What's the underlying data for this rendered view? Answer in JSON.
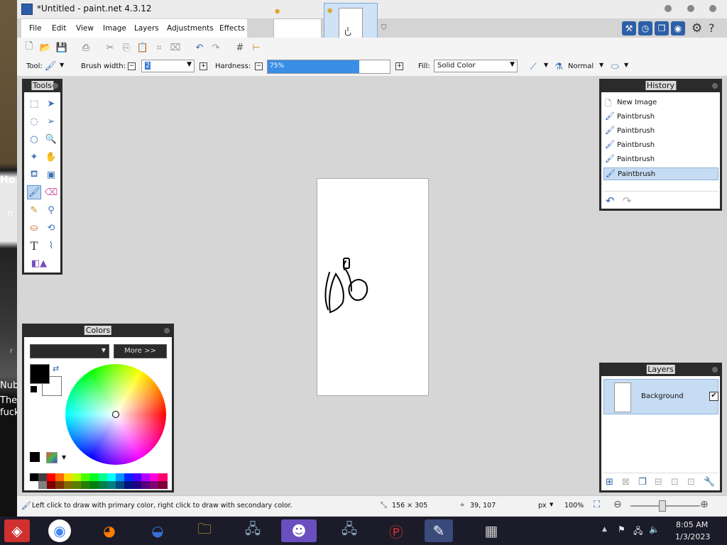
{
  "window": {
    "title": "*Untitled - paint.net 4.3.12"
  },
  "menu": [
    "File",
    "Edit",
    "View",
    "Image",
    "Layers",
    "Adjustments",
    "Effects"
  ],
  "toolbar": {
    "tool_label": "Tool:",
    "brush_width_label": "Brush width:",
    "brush_width_value": "2",
    "hardness_label": "Hardness:",
    "hardness_value": "75%",
    "hardness_fraction": 0.75,
    "fill_label": "Fill:",
    "fill_value": "Solid Color",
    "blend_mode": "Normal"
  },
  "background_left": {
    "heading_partial": "Ho",
    "chip_partial": "n",
    "nub_partial": "Nub",
    "the_partial": "The",
    "fuck_partial": "fuck",
    "r_partial": "r"
  },
  "tools_panel": {
    "title": "Tools",
    "tools": [
      "rectangle-select-icon",
      "move-selection-icon",
      "lasso-select-icon",
      "move-selected-icon",
      "ellipse-select-icon",
      "zoom-icon",
      "magic-wand-icon",
      "pan-icon",
      "paint-bucket-icon",
      "gradient-icon",
      "paintbrush-icon",
      "eraser-icon",
      "pencil-icon",
      "color-picker-icon",
      "clone-stamp-icon",
      "recolor-icon",
      "text-icon",
      "line-curve-icon",
      "shapes-icon"
    ],
    "selected": "paintbrush-icon"
  },
  "history_panel": {
    "title": "History",
    "items": [
      {
        "label": "New Image",
        "icon": "document-icon"
      },
      {
        "label": "Paintbrush",
        "icon": "paintbrush-icon"
      },
      {
        "label": "Paintbrush",
        "icon": "paintbrush-icon"
      },
      {
        "label": "Paintbrush",
        "icon": "paintbrush-icon"
      },
      {
        "label": "Paintbrush",
        "icon": "paintbrush-icon"
      },
      {
        "label": "Paintbrush",
        "icon": "paintbrush-icon"
      }
    ],
    "selected_index": 5
  },
  "colors_panel": {
    "title": "Colors",
    "more_button": "More >>",
    "primary_color": "#000000",
    "secondary_color": "#ffffff"
  },
  "layers_panel": {
    "title": "Layers",
    "layers": [
      {
        "name": "Background",
        "visible": true
      }
    ]
  },
  "status": {
    "hint": "Left click to draw with primary color, right click to draw with secondary color.",
    "image_size": "156 × 305",
    "cursor_pos": "39, 107",
    "units": "px",
    "zoom": "100%"
  },
  "taskbar": {
    "time": "8:05 AM",
    "date": "1/3/2023"
  },
  "colors": {
    "accent": "#2d5fa8",
    "selection": "#c6dcf3",
    "panel_border": "#2b2b2b"
  }
}
